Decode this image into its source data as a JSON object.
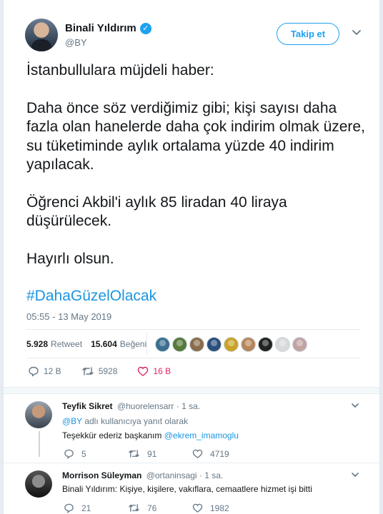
{
  "header": {
    "author_name": "Binali Yıldırım",
    "verified_mark": "✓",
    "handle": "@BY",
    "follow_label": "Takip et",
    "more_icon": "chevron-down-icon"
  },
  "tweet": {
    "paragraphs": [
      "İstanbullulara müjdeli haber:",
      "Daha önce söz verdiğimiz gibi; kişi sayısı daha fazla olan hanelerde daha çok indirim olmak üzere, su tüketiminde aylık ortalama yüzde 40 indirim yapılacak.",
      "Öğrenci Akbil'i aylık 85 liradan 40 liraya düşürülecek.",
      "Hayırlı olsun."
    ],
    "hashtag": "#DahaGüzelOlacak",
    "timestamp": "05:55 - 13 May 2019"
  },
  "stats": {
    "retweet_count": "5.928",
    "retweet_label": "Retweet",
    "like_count": "15.604",
    "like_label": "Beğeni",
    "face_colors": [
      "#3b6e8f",
      "#557a3a",
      "#8a6d4a",
      "#2a4f7a",
      "#c9a227",
      "#b8865b",
      "#222222",
      "#d9d9d9",
      "#c2a3a3"
    ]
  },
  "actions": {
    "reply_count": "12 B",
    "retweet_count": "5928",
    "like_count": "16 B"
  },
  "replies": [
    {
      "name": "Teyfik Sikret",
      "handle": "@huorelensarr",
      "time": "· 1 sa.",
      "reply_to_prefix": "@BY",
      "reply_to_suffix": " adlı kullanıcıya yanıt olarak",
      "text_prefix": "Teşekkür ederiz başkanım ",
      "text_mention": "@ekrem_imamoglu",
      "reply_count": "5",
      "retweet_count": "91",
      "like_count": "4719"
    },
    {
      "name": "Morrison Süleyman",
      "handle": "@ortaninsagi",
      "time": "· 1 sa.",
      "text": "Binali Yıldırım: Kişiye, kişilere, vakıflara, cemaatlere hizmet işi bitti",
      "reply_count": "21",
      "retweet_count": "76",
      "like_count": "1982"
    }
  ],
  "colors": {
    "accent": "#1da1f2",
    "link": "#1b95e0",
    "like": "#e0245e",
    "muted": "#657786"
  }
}
